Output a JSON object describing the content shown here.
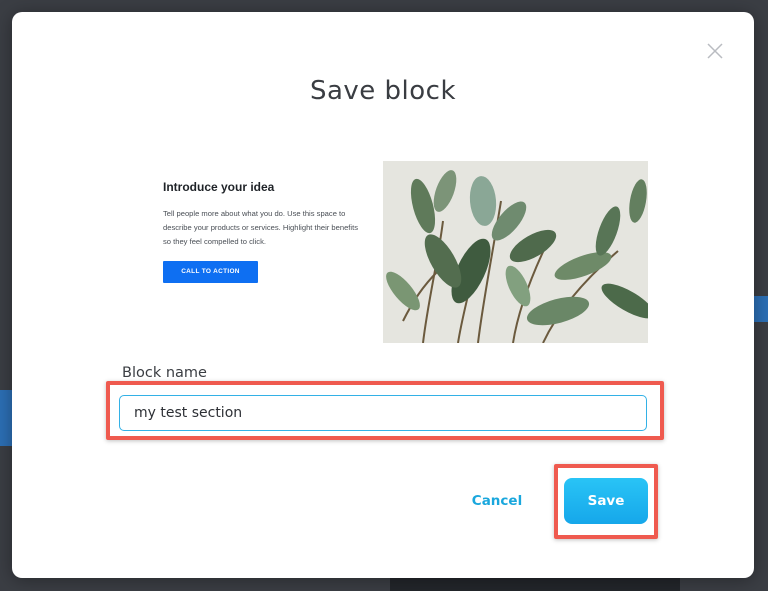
{
  "modal": {
    "title": "Save block",
    "close_icon": "close-icon"
  },
  "preview": {
    "heading": "Introduce your idea",
    "body": "Tell people more about what you do. Use this space to describe your products or services. Highlight their benefits so they feel compelled to click.",
    "cta_label": "CALL TO ACTION",
    "image": "plant-photo"
  },
  "form": {
    "label": "Block name",
    "value": "my test section"
  },
  "actions": {
    "cancel_label": "Cancel",
    "save_label": "Save"
  },
  "colors": {
    "accent": "#1aa7dd",
    "save_button": "#1ab3ee",
    "highlight": "#ef5a4f",
    "cta": "#0e6ff2"
  }
}
